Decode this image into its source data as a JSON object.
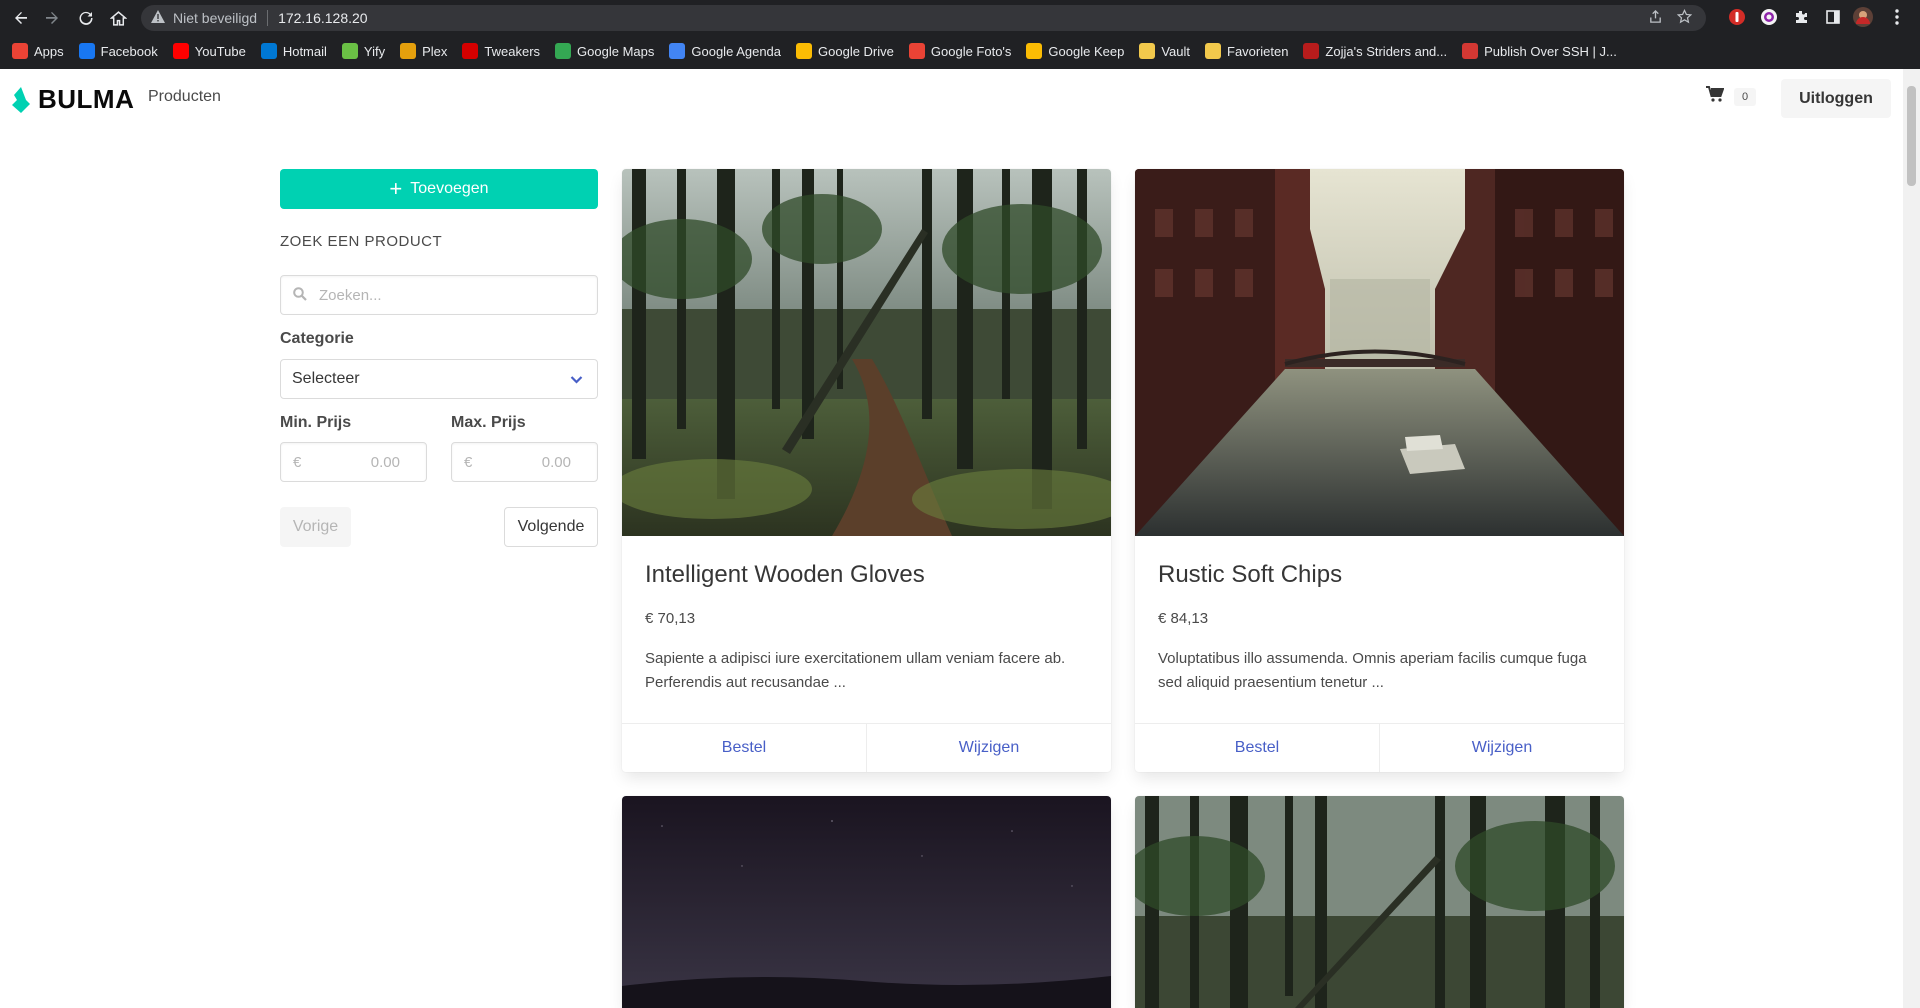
{
  "browser": {
    "security_label": "Niet beveiligd",
    "url": "172.16.128.20",
    "bookmarks": [
      {
        "label": "Apps",
        "icon": "apps-grid-icon",
        "color": "#ea4335"
      },
      {
        "label": "Facebook",
        "icon": "facebook-icon",
        "color": "#1877f2"
      },
      {
        "label": "YouTube",
        "icon": "youtube-icon",
        "color": "#ff0000"
      },
      {
        "label": "Hotmail",
        "icon": "outlook-icon",
        "color": "#0078d4"
      },
      {
        "label": "Yify",
        "icon": "yify-icon",
        "color": "#6ac045"
      },
      {
        "label": "Plex",
        "icon": "plex-icon",
        "color": "#e5a00d"
      },
      {
        "label": "Tweakers",
        "icon": "tweakers-icon",
        "color": "#d50000"
      },
      {
        "label": "Google Maps",
        "icon": "maps-pin-icon",
        "color": "#34a853"
      },
      {
        "label": "Google Agenda",
        "icon": "calendar-icon",
        "color": "#4285f4"
      },
      {
        "label": "Google Drive",
        "icon": "drive-icon",
        "color": "#fbbc04"
      },
      {
        "label": "Google Foto's",
        "icon": "photos-icon",
        "color": "#ea4335"
      },
      {
        "label": "Google Keep",
        "icon": "keep-icon",
        "color": "#fbbc04"
      },
      {
        "label": "Vault",
        "icon": "folder-icon",
        "color": "#f2c94c"
      },
      {
        "label": "Favorieten",
        "icon": "folder-icon",
        "color": "#f2c94c"
      },
      {
        "label": "Zojja's Striders and...",
        "icon": "zojja-icon",
        "color": "#b71c1c"
      },
      {
        "label": "Publish Over SSH | J...",
        "icon": "jenkins-icon",
        "color": "#d33833"
      }
    ]
  },
  "navbar": {
    "brand": "BULMA",
    "nav_item": "Producten",
    "cart_count": "0",
    "logout": "Uitloggen",
    "accent": "#00d1b2"
  },
  "sidebar": {
    "add_label": "Toevoegen",
    "search_title": "ZOEK EEN PRODUCT",
    "search_placeholder": "Zoeken...",
    "category_label": "Categorie",
    "category_value": "Selecteer",
    "min_label": "Min. Prijs",
    "max_label": "Max. Prijs",
    "currency": "€",
    "min_placeholder": "0.00",
    "max_placeholder": "0.00",
    "prev": "Vorige",
    "next": "Volgende"
  },
  "products": [
    {
      "title": "Intelligent Wooden Gloves",
      "price": "€ 70,13",
      "description": "Sapiente a adipisci iure exercitationem ullam veniam facere ab. Perferendis aut recusandae ...",
      "order": "Bestel",
      "edit": "Wijzigen",
      "image": "forest-path"
    },
    {
      "title": "Rustic Soft Chips",
      "price": "€ 84,13",
      "description": "Voluptatibus illo assumenda. Omnis aperiam facilis cumque fuga sed aliquid praesentium tenetur ...",
      "order": "Bestel",
      "edit": "Wijzigen",
      "image": "canal-city"
    }
  ]
}
